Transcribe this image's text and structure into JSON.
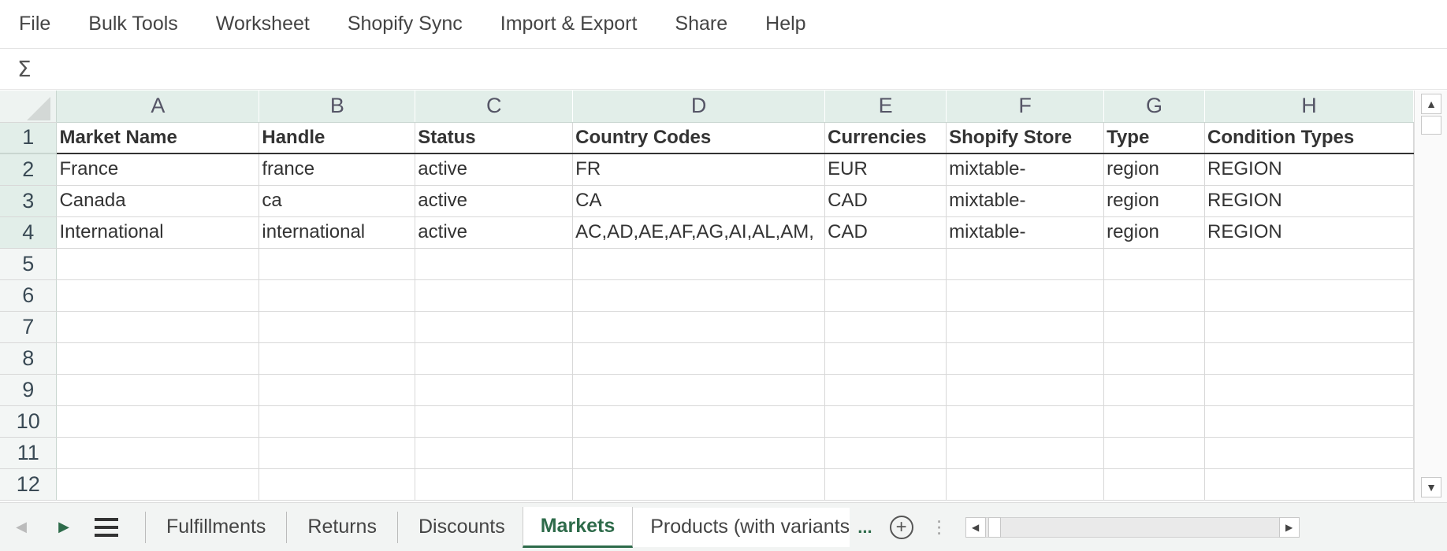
{
  "menu": [
    "File",
    "Bulk Tools",
    "Worksheet",
    "Shopify Sync",
    "Import & Export",
    "Share",
    "Help"
  ],
  "formula": {
    "icon": "Σ"
  },
  "columns": [
    "A",
    "B",
    "C",
    "D",
    "E",
    "F",
    "G",
    "H"
  ],
  "rows": [
    [
      "Market Name",
      "Handle",
      "Status",
      "Country Codes",
      "Currencies",
      "Shopify Store",
      "Type",
      "Condition Types"
    ],
    [
      "France",
      "france",
      "active",
      "FR",
      "EUR",
      "mixtable-",
      "region",
      "REGION"
    ],
    [
      "Canada",
      "ca",
      "active",
      "CA",
      "CAD",
      "mixtable-",
      "region",
      "REGION"
    ],
    [
      "International",
      "international",
      "active",
      "AC,AD,AE,AF,AG,AI,AL,AM,",
      "CAD",
      "mixtable-",
      "region",
      "REGION"
    ],
    [
      "",
      "",
      "",
      "",
      "",
      "",
      "",
      ""
    ],
    [
      "",
      "",
      "",
      "",
      "",
      "",
      "",
      ""
    ],
    [
      "",
      "",
      "",
      "",
      "",
      "",
      "",
      ""
    ],
    [
      "",
      "",
      "",
      "",
      "",
      "",
      "",
      ""
    ],
    [
      "",
      "",
      "",
      "",
      "",
      "",
      "",
      ""
    ],
    [
      "",
      "",
      "",
      "",
      "",
      "",
      "",
      ""
    ],
    [
      "",
      "",
      "",
      "",
      "",
      "",
      "",
      ""
    ],
    [
      "",
      "",
      "",
      "",
      "",
      "",
      "",
      ""
    ]
  ],
  "row_numbers": [
    "1",
    "2",
    "3",
    "4",
    "5",
    "6",
    "7",
    "8",
    "9",
    "10",
    "11",
    "12"
  ],
  "sheets": [
    "Fulfillments",
    "Returns",
    "Discounts",
    "Markets",
    "Products (with variants)"
  ],
  "active_sheet": "Markets",
  "tabbar": {
    "more": "...",
    "add": "+",
    "dots": "⋮"
  },
  "colors": {
    "accent": "#2e6b4a",
    "header_bg": "#e2eee9"
  }
}
